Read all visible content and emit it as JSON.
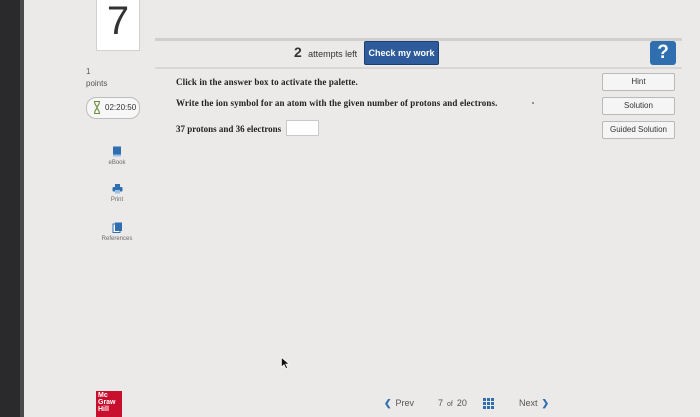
{
  "question_number": "7",
  "header": {
    "attempts_count": "2",
    "attempts_text": "attempts left",
    "check_label": "Check my work",
    "help_label": "?"
  },
  "sidebar": {
    "points_value": "1",
    "points_label": "points",
    "timer": "02:20:50",
    "tools": [
      {
        "label": "eBook",
        "icon": "book-icon"
      },
      {
        "label": "Print",
        "icon": "printer-icon"
      },
      {
        "label": "References",
        "icon": "references-icon"
      }
    ],
    "logo_lines": [
      "Mc",
      "Graw",
      "Hill"
    ]
  },
  "main": {
    "instruction": "Click in the answer box to activate the palette.",
    "prompt": "Write the ion symbol for an atom with the given number of protons and electrons.",
    "question": "37 protons and 36 electrons",
    "answer_value": ""
  },
  "right_buttons": [
    "Hint",
    "Solution",
    "Guided Solution"
  ],
  "footer": {
    "prev_label": "Prev",
    "current_page": "7",
    "of_text": "of",
    "total_pages": "20",
    "next_label": "Next"
  },
  "colors": {
    "accent_blue": "#2d5b9c",
    "help_blue": "#2f6fb0",
    "brand_red": "#c8102e"
  }
}
